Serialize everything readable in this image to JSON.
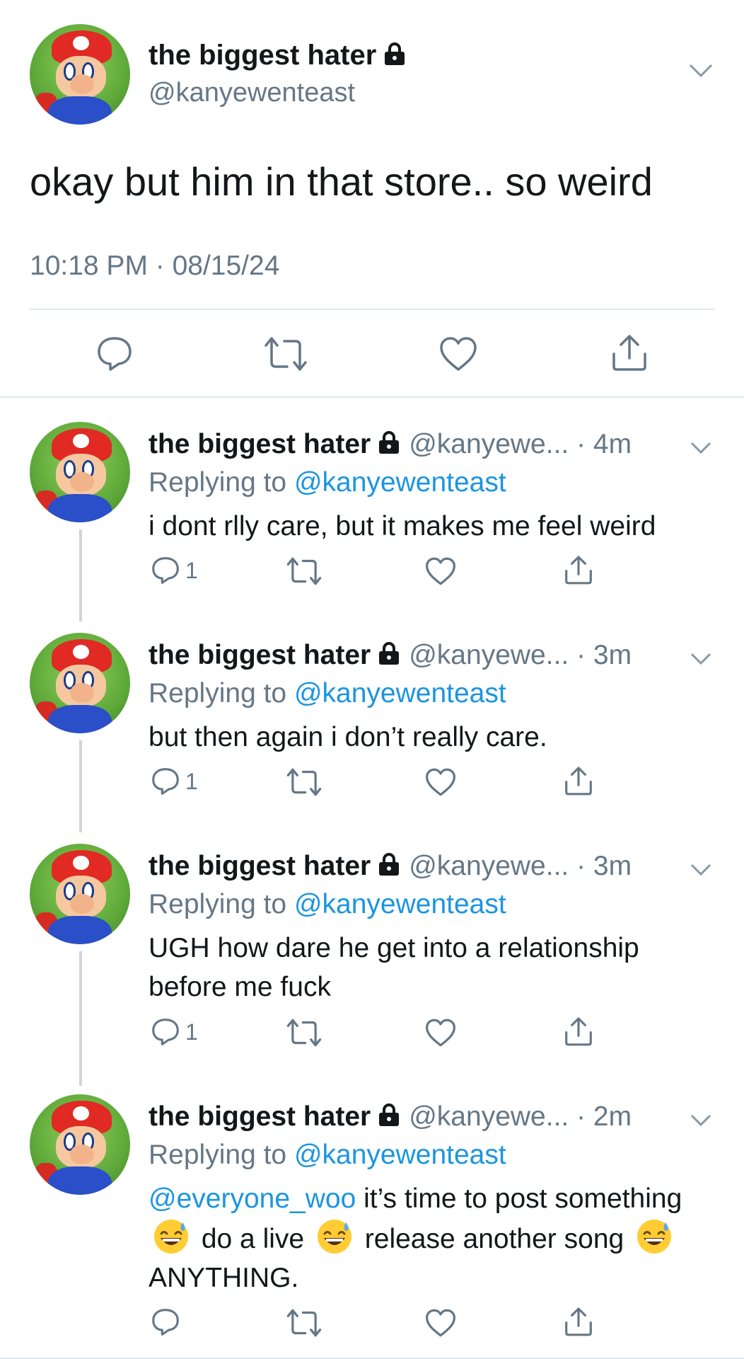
{
  "main_tweet": {
    "display_name": "the biggest hater",
    "handle": "@kanyewenteast",
    "text": "okay but him in that store.. so weird",
    "meta": "10:18 PM · 08/15/24"
  },
  "replies": [
    {
      "display_name": "the biggest hater",
      "handle": "@kanyewe...",
      "separator": " · ",
      "time": "4m",
      "replying_prefix": "Replying to ",
      "replying_to": "@kanyewenteast",
      "text": "i dont rlly care, but it makes me feel weird",
      "reply_count": "1"
    },
    {
      "display_name": "the biggest hater",
      "handle": "@kanyewe...",
      "separator": " · ",
      "time": "3m",
      "replying_prefix": "Replying to ",
      "replying_to": "@kanyewenteast",
      "text": "but then again i don’t really care.",
      "reply_count": "1"
    },
    {
      "display_name": "the biggest hater",
      "handle": "@kanyewe...",
      "separator": " · ",
      "time": "3m",
      "replying_prefix": "Replying to ",
      "replying_to": "@kanyewenteast",
      "text": "UGH how dare he get into a relationship before me fuck",
      "reply_count": "1"
    },
    {
      "display_name": "the biggest hater",
      "handle": "@kanyewe...",
      "separator": " · ",
      "time": "2m",
      "replying_prefix": "Replying to ",
      "replying_to": "@kanyewenteast",
      "text_mention": "@everyone_woo",
      "text_parts": [
        " it’s time to post something ",
        " do a live ",
        " release another song ",
        " ANYTHING."
      ],
      "reply_count": ""
    }
  ],
  "colors": {
    "link": "#1b95e0",
    "secondary": "#657786",
    "primary": "#14171a",
    "divider": "#e1e8ed",
    "thread_line": "#ccd6dd"
  },
  "icons": [
    "lock-icon",
    "chevron-down-icon",
    "reply-icon",
    "retweet-icon",
    "like-icon",
    "share-icon",
    "grinning-sweat-emoji"
  ]
}
